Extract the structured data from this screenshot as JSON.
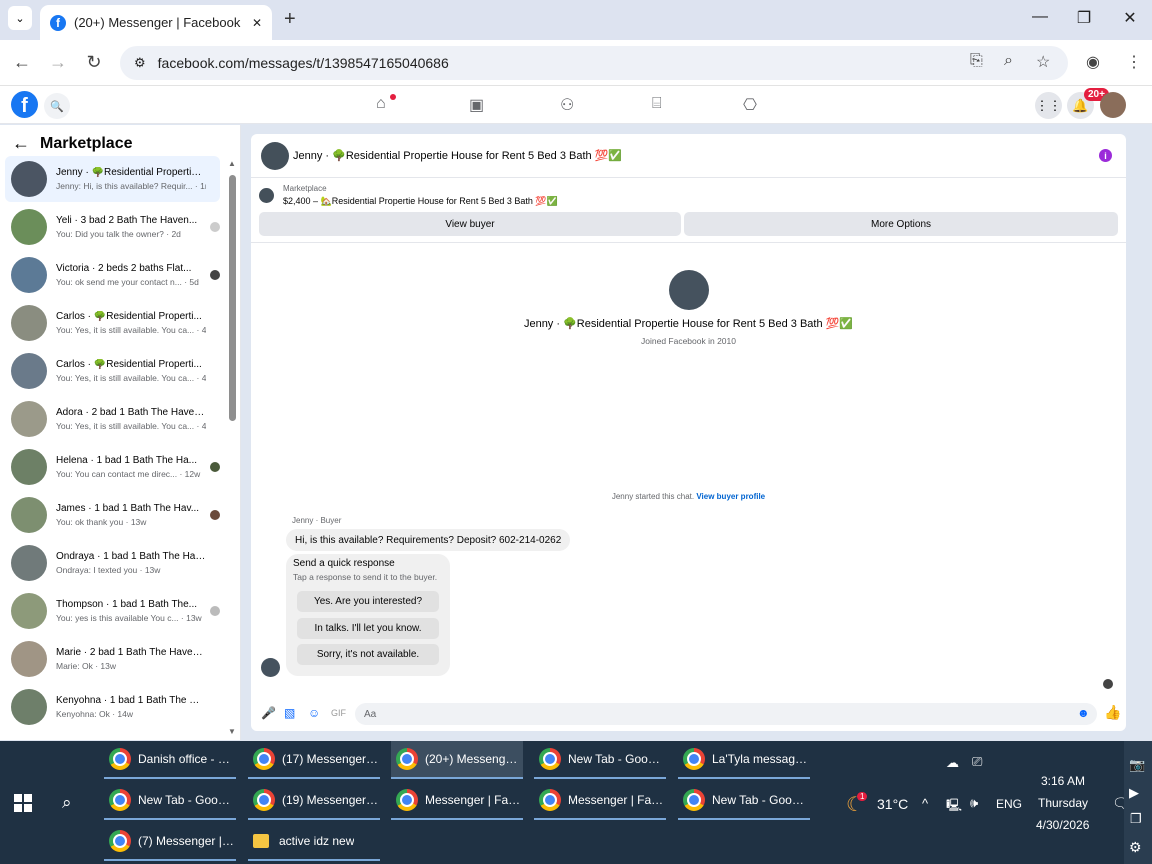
{
  "browser": {
    "tab_title": "(20+) Messenger | Facebook",
    "url": "facebook.com/messages/t/1398547165040686",
    "new_tab": "+",
    "minimize": "—",
    "maximize": "❐",
    "close": "✕"
  },
  "fb": {
    "logo": "f",
    "notif_badge": "20+"
  },
  "sidebar": {
    "title": "Marketplace",
    "conversations": [
      {
        "name": "Jenny · 🌳Residential Propertie House for Rent 5 Bed 3 Bath",
        "preview": "Jenny: Hi, is this available? Requir... · 1m"
      },
      {
        "name": "Yeli · 3 bad 2 Bath The Haven...",
        "preview": "You: Did you talk the owner? · 2d"
      },
      {
        "name": "Victoria · 2 beds 2 baths Flat...",
        "preview": "You: ok send me your contact n... · 5d"
      },
      {
        "name": "Carlos · 🌳Residential Properti...",
        "preview": "You: Yes, it is still available. You ca... · 4w"
      },
      {
        "name": "Carlos · 🌳Residential Properti...",
        "preview": "You: Yes, it is still available. You ca... · 4w"
      },
      {
        "name": "Adora · 2 bad 1 Bath The Haven...",
        "preview": "You: Yes, it is still available. You ca... · 4w"
      },
      {
        "name": "Helena · 1 bad 1 Bath The Ha...",
        "preview": "You: You can contact me direc... · 12w"
      },
      {
        "name": "James · 1 bad 1 Bath The Hav...",
        "preview": "You: ok thank you · 13w"
      },
      {
        "name": "Ondraya · 1 bad 1 Bath The Hav...",
        "preview": "Ondraya: I texted you · 13w"
      },
      {
        "name": "Thompson · 1 bad 1 Bath The...",
        "preview": "You: yes is this available You c... · 13w"
      },
      {
        "name": "Marie · 2 bad 1 Bath The Haven...",
        "preview": "Marie: Ok · 13w"
      },
      {
        "name": "Kenyohna · 1 bad 1 Bath The Ha...",
        "preview": "Kenyohna: Ok · 14w"
      }
    ]
  },
  "chat": {
    "header_name": "Jenny · 🌳Residential Propertie House for Rent 5 Bed 3 Bath 💯✅",
    "info": "i",
    "marketplace_label": "Marketplace",
    "listing": "$2,400 – 🏡Residential Propertie House for Rent 5 Bed 3 Bath 💯✅",
    "view_buyer": "View buyer",
    "more_options": "More Options",
    "profile_name": "Jenny · 🌳Residential Propertie House for Rent 5 Bed 3 Bath 💯✅",
    "joined": "Joined Facebook in 2010",
    "started_text": "Jenny started this chat.",
    "view_profile": "View buyer profile",
    "sender_label": "Jenny · Buyer",
    "message": "Hi, is this available? Requirements? Deposit? 602-214-0262",
    "quick_title": "Send a quick response",
    "quick_sub": "Tap a response to send it to the buyer.",
    "quick_replies": [
      "Yes. Are you interested?",
      "In talks. I'll let you know.",
      "Sorry, it's not available."
    ],
    "composer_placeholder": "Aa"
  },
  "taskbar": {
    "rows": [
      [
        "Danish office - G...",
        "(17) Messenger | ...",
        "(20+) Messenger...",
        "New Tab - Googl...",
        "La'Tyla message..."
      ],
      [
        "New Tab - Googl...",
        "(19) Messenger | ...",
        "Messenger | Fac...",
        "Messenger | Fac...",
        "New Tab - Googl..."
      ],
      [
        "(7) Messenger | Fac...",
        "active idz new"
      ]
    ],
    "weather": "31°C",
    "weather_badge": "1",
    "lang": "ENG",
    "time": "3:16 AM",
    "day": "Thursday",
    "date": "4/30/2026"
  },
  "colors": {
    "accent": "#1877f2",
    "messenger_blue": "#0866ff",
    "badge_red": "#e41e3f",
    "taskbar": "#1f3143"
  }
}
